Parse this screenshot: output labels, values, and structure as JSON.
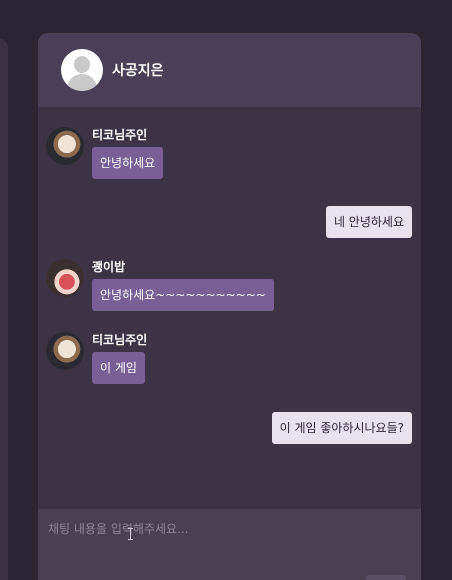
{
  "header": {
    "name": "사공지은",
    "avatar_icon": "default-user-icon"
  },
  "messages": [
    {
      "sender": "티코님주인",
      "text": "안녕하세요"
    },
    {
      "text": "네 안녕하세요"
    },
    {
      "sender": "괭이밥",
      "text": "안녕하세요~~~~~~~~~~~"
    },
    {
      "sender": "티코님주인",
      "text": "이 게임"
    },
    {
      "text": "이 게임 좋아하시나요들?"
    }
  ],
  "input": {
    "placeholder": "채팅 내용을 입력해주세요..."
  },
  "colors": {
    "background": "#2b2533",
    "panel": "#3c3446",
    "header": "#4a3f58",
    "incoming_bubble": "#7a5f96",
    "outgoing_bubble": "#e8e2ee"
  }
}
